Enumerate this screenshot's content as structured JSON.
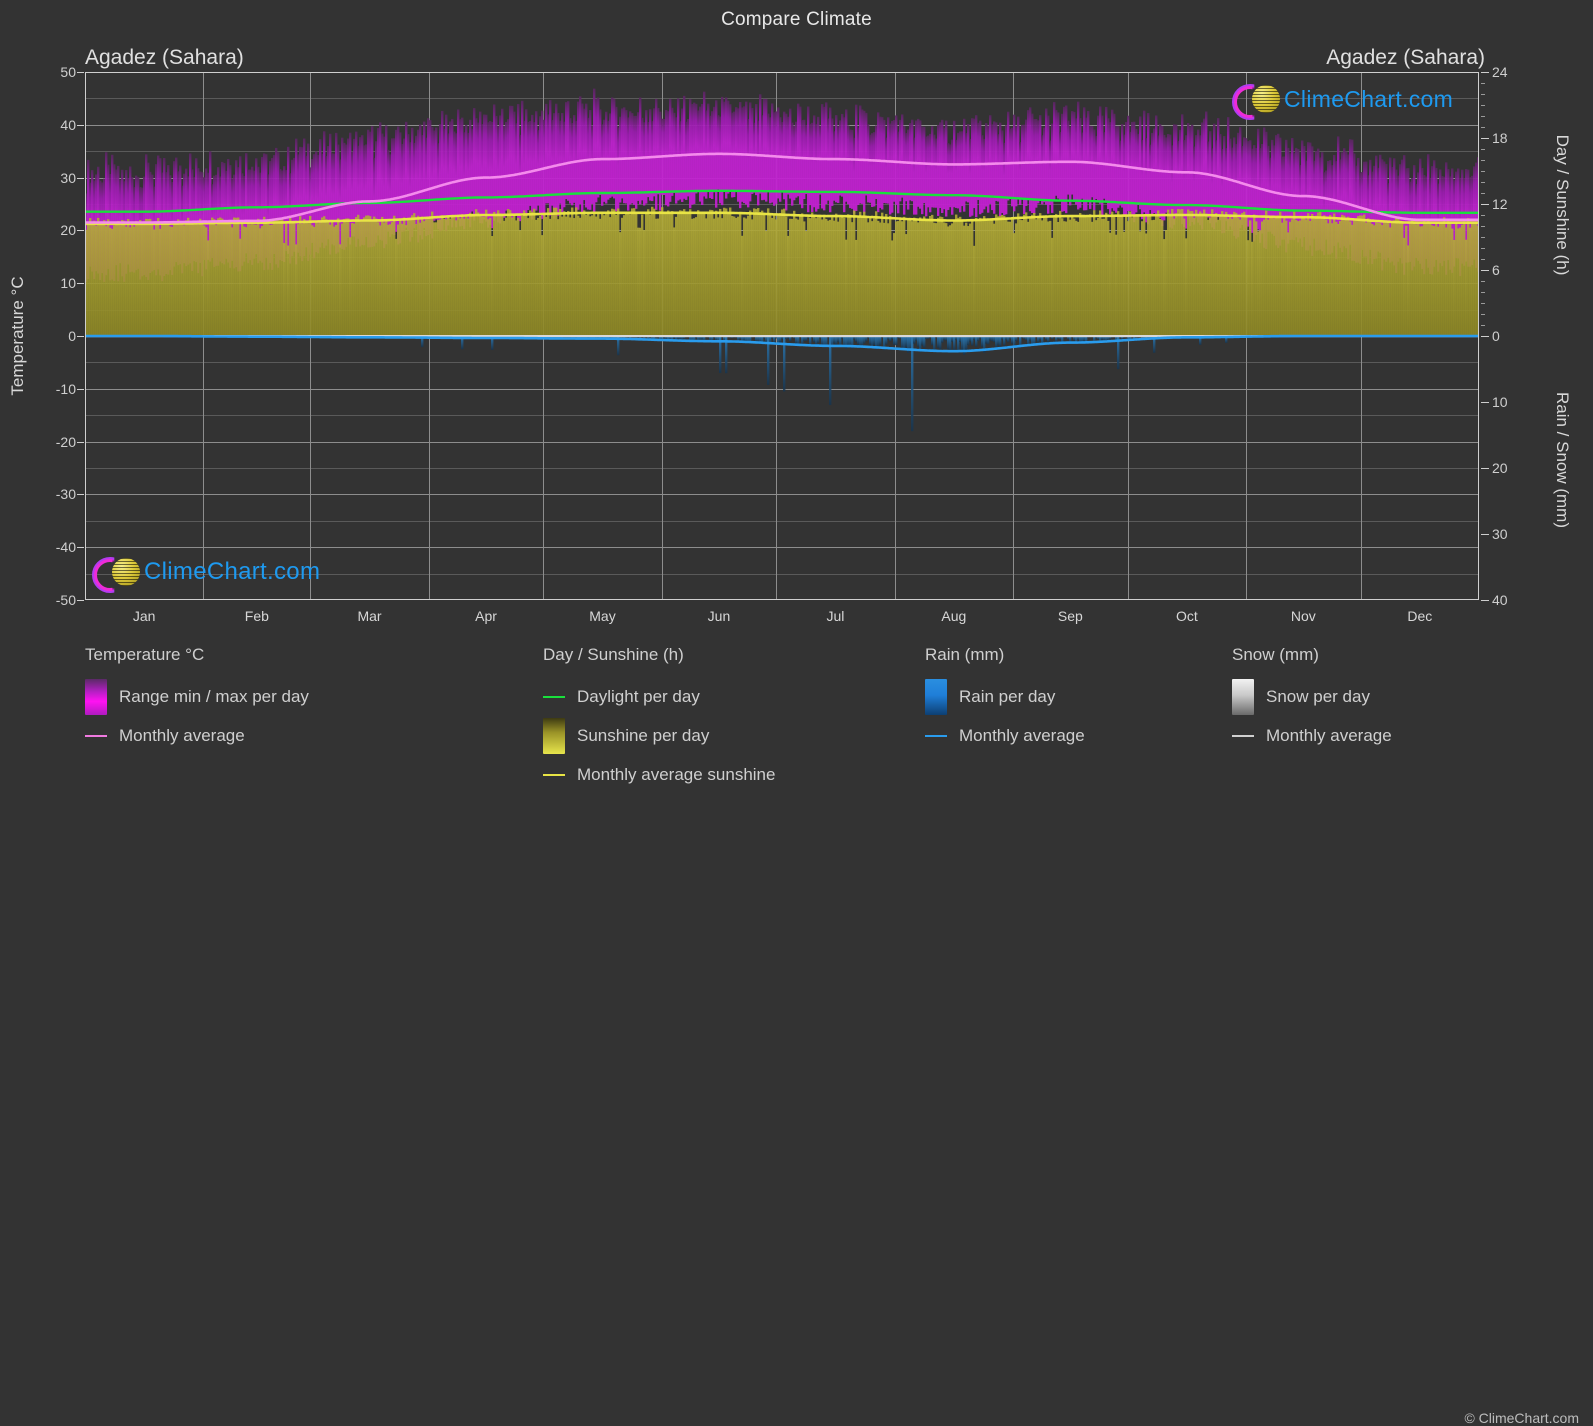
{
  "header": {
    "chart_title": "Compare Climate",
    "left_location": "Agadez (Sahara)",
    "right_location": "Agadez (Sahara)"
  },
  "watermark": {
    "text": "ClimeChart.com",
    "copyright": "© ClimeChart.com"
  },
  "axes": {
    "left_title": "Temperature °C",
    "right_top_title": "Day / Sunshine (h)",
    "right_bottom_title": "Rain / Snow (mm)",
    "temp_ticks": [
      "50",
      "40",
      "30",
      "20",
      "10",
      "0",
      "-10",
      "-20",
      "-30",
      "-40",
      "-50"
    ],
    "sun_ticks": [
      "24",
      "18",
      "12",
      "6",
      "0"
    ],
    "rain_ticks": [
      "0",
      "10",
      "20",
      "30",
      "40"
    ],
    "months": [
      "Jan",
      "Feb",
      "Mar",
      "Apr",
      "May",
      "Jun",
      "Jul",
      "Aug",
      "Sep",
      "Oct",
      "Nov",
      "Dec"
    ]
  },
  "legend": {
    "temperature": {
      "heading": "Temperature °C",
      "items": [
        {
          "label": "Range min / max per day",
          "swatch": "gradient-magenta",
          "color": "#ff12f2"
        },
        {
          "label": "Monthly average",
          "swatch": "line",
          "color": "#f07ae0"
        }
      ]
    },
    "day_sunshine": {
      "heading": "Day / Sunshine (h)",
      "items": [
        {
          "label": "Daylight per day",
          "swatch": "line",
          "color": "#19e03c"
        },
        {
          "label": "Sunshine per day",
          "swatch": "gradient-yellow",
          "color": "#e7e54c"
        },
        {
          "label": "Monthly average sunshine",
          "swatch": "line",
          "color": "#e8e445"
        }
      ]
    },
    "rain": {
      "heading": "Rain (mm)",
      "items": [
        {
          "label": "Rain per day",
          "swatch": "gradient-blue",
          "color": "#1f8ae0"
        },
        {
          "label": "Monthly average",
          "swatch": "line",
          "color": "#2a9ced"
        }
      ]
    },
    "snow": {
      "heading": "Snow (mm)",
      "items": [
        {
          "label": "Snow per day",
          "swatch": "gradient-white",
          "color": "#e8e8e8"
        },
        {
          "label": "Monthly average",
          "swatch": "line",
          "color": "#d0d0d0"
        }
      ]
    }
  },
  "colors": {
    "background": "#333333",
    "grid": "#8d8d8d",
    "axis": "#cfcfcf",
    "temp_band": "#b51fc4",
    "temp_avg_line": "#f48bec",
    "daylight_line": "#19e03c",
    "sunshine_fill": "#9a9327",
    "sunshine_line": "#e8e445",
    "rain_fill": "#1f5e8f",
    "rain_line": "#2a9ced",
    "logo_blue": "#1e9af0"
  },
  "chart_data": {
    "type": "area",
    "title": "Compare Climate",
    "subtitle": "Agadez (Sahara)",
    "xlabel": "",
    "ylabel": "Temperature °C",
    "ylabel_right_top": "Day / Sunshine (h)",
    "ylabel_right_bottom": "Rain / Snow (mm)",
    "ylim_temp": [
      -50,
      50
    ],
    "ylim_sun": [
      0,
      24
    ],
    "ylim_rain": [
      0,
      40
    ],
    "grid": true,
    "legend_position": "below",
    "categories": [
      "Jan",
      "Feb",
      "Mar",
      "Apr",
      "May",
      "Jun",
      "Jul",
      "Aug",
      "Sep",
      "Oct",
      "Nov",
      "Dec"
    ],
    "series": [
      {
        "name": "Monthly average temperature (°C)",
        "unit": "°C",
        "color": "#f48bec",
        "values": [
          21.5,
          21.8,
          25.5,
          30.0,
          33.5,
          34.5,
          33.5,
          32.5,
          33.0,
          31.0,
          26.5,
          22.0
        ]
      },
      {
        "name": "Daily max temperature range top (°C)",
        "unit": "°C",
        "color": "#b51fc4",
        "values": [
          31,
          33,
          37,
          41,
          43,
          43,
          41,
          39,
          41,
          39,
          35,
          31
        ]
      },
      {
        "name": "Daily min temperature range bottom (°C)",
        "unit": "°C",
        "color": "#7b2b8a",
        "values": [
          12,
          14,
          18,
          22,
          25,
          26,
          25,
          24,
          25,
          22,
          17,
          13
        ]
      },
      {
        "name": "Daylight per day (h)",
        "unit": "h",
        "color": "#19e03c",
        "values": [
          11.3,
          11.7,
          12.1,
          12.6,
          13.0,
          13.2,
          13.1,
          12.8,
          12.3,
          11.9,
          11.4,
          11.2
        ]
      },
      {
        "name": "Monthly average sunshine (h)",
        "unit": "h",
        "color": "#e8e445",
        "values": [
          10.2,
          10.3,
          10.5,
          11.0,
          11.2,
          11.2,
          10.9,
          10.5,
          10.9,
          11.0,
          10.8,
          10.3
        ]
      },
      {
        "name": "Monthly average rain (mm)",
        "unit": "mm",
        "color": "#2a9ced",
        "values": [
          0.0,
          0.1,
          0.2,
          0.3,
          0.4,
          0.8,
          1.5,
          2.3,
          1.0,
          0.2,
          0.0,
          0.0
        ]
      },
      {
        "name": "Monthly average snow (mm)",
        "unit": "mm",
        "color": "#d0d0d0",
        "values": [
          0,
          0,
          0,
          0,
          0,
          0,
          0,
          0,
          0,
          0,
          0,
          0
        ]
      }
    ]
  }
}
